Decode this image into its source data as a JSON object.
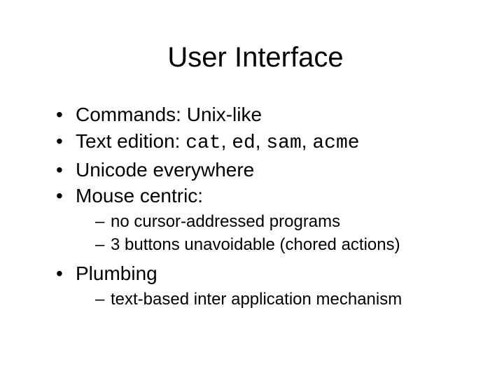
{
  "title": "User Interface",
  "bullets": {
    "b1": "Commands: Unix-like",
    "b2_prefix": "Text edition: ",
    "b2_cat": "cat",
    "b2_ed": "ed",
    "b2_sam": "sam",
    "b2_acme": "acme",
    "b2_sep": ", ",
    "b3": "Unicode everywhere",
    "b4": "Mouse centric:",
    "b4_sub1": "no cursor-addressed programs",
    "b4_sub2": "3 buttons unavoidable (chored actions)",
    "b5": "Plumbing",
    "b5_sub1": "text-based inter application mechanism"
  }
}
